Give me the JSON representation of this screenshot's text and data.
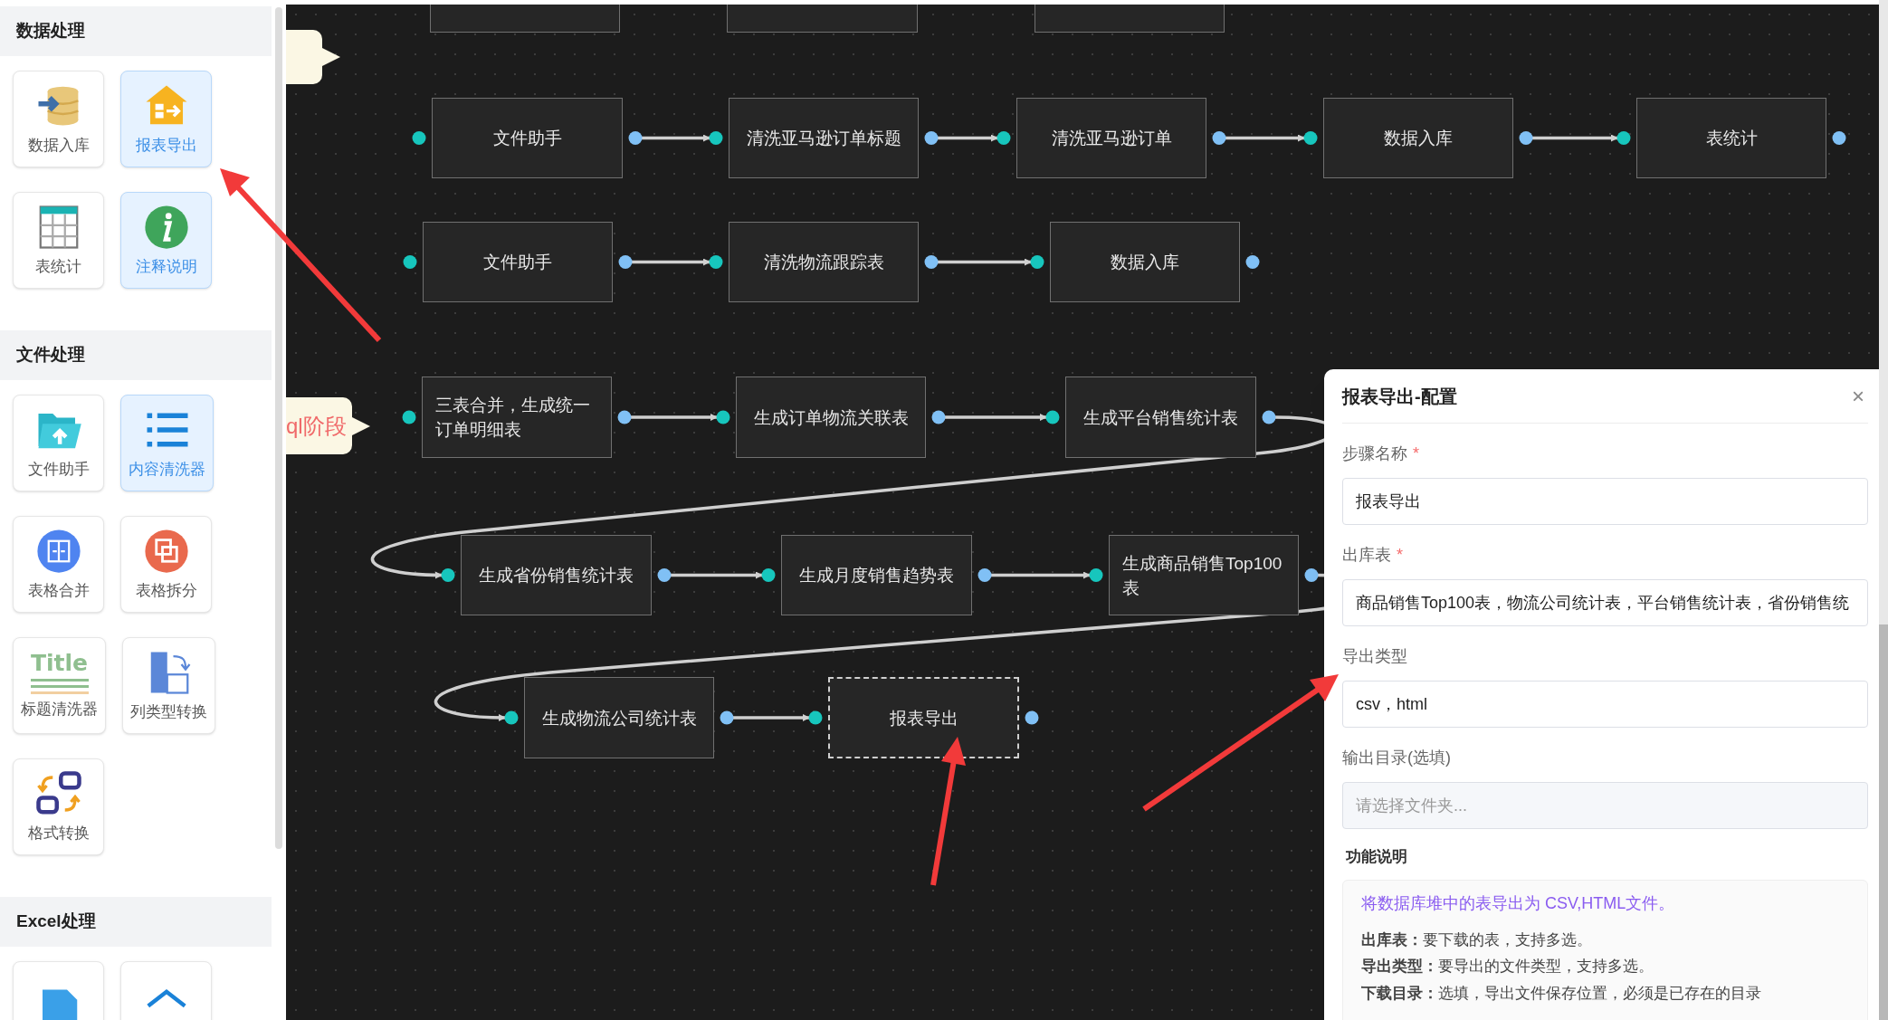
{
  "sidebar": {
    "sections": [
      {
        "title": "数据处理",
        "items": [
          {
            "label": "数据入库",
            "selected": false
          },
          {
            "label": "报表导出",
            "selected": true
          },
          {
            "label": "表统计",
            "selected": false
          },
          {
            "label": "注释说明",
            "selected": true
          }
        ]
      },
      {
        "title": "文件处理",
        "items": [
          {
            "label": "文件助手",
            "selected": false
          },
          {
            "label": "内容清洗器",
            "selected": true
          },
          {
            "label": "表格合并",
            "selected": false
          },
          {
            "label": "表格拆分",
            "selected": false
          },
          {
            "label": "标题清洗器",
            "selected": false,
            "icon_text": "Title"
          },
          {
            "label": "列类型转换",
            "selected": false
          },
          {
            "label": "格式转换",
            "selected": false
          }
        ]
      },
      {
        "title": "Excel处理",
        "items": [
          {
            "selected": false
          },
          {
            "selected": false
          }
        ]
      }
    ]
  },
  "canvas": {
    "callouts": [
      {
        "text": "ql阶段"
      }
    ],
    "nodes": [
      {
        "selected": false
      },
      {
        "selected": false
      },
      {
        "selected": false
      },
      {
        "label": "文件助手",
        "selected": false
      },
      {
        "label": "清洗亚马逊订单标题",
        "selected": false
      },
      {
        "label": "清洗亚马逊订单",
        "selected": false
      },
      {
        "label": "数据入库",
        "selected": false
      },
      {
        "label": "表统计",
        "selected": false
      },
      {
        "label": "文件助手",
        "selected": false
      },
      {
        "label": "清洗物流跟踪表",
        "selected": false
      },
      {
        "label": "数据入库",
        "selected": false
      },
      {
        "label": "三表合并，生成统一订单明细表",
        "selected": false
      },
      {
        "label": "生成订单物流关联表",
        "selected": false
      },
      {
        "label": "生成平台销售统计表",
        "selected": false
      },
      {
        "label": "生成省份销售统计表",
        "selected": false
      },
      {
        "label": "生成月度销售趋势表",
        "selected": false
      },
      {
        "label": "生成商品销售Top100表",
        "selected": false
      },
      {
        "label": "生成物流公司统计表",
        "selected": false
      },
      {
        "label": "报表导出",
        "selected": true
      }
    ]
  },
  "config_panel": {
    "title": "报表导出-配置",
    "close": "×",
    "fields": [
      {
        "label": "步骤名称",
        "required_mark": "*",
        "value": "报表导出"
      },
      {
        "label": "出库表",
        "required_mark": "*",
        "value": "商品销售Top100表，物流公司统计表，平台销售统计表，省份销售统"
      },
      {
        "label": "导出类型",
        "value": "csv，html"
      },
      {
        "label": "输出目录(选填)",
        "placeholder": "请选择文件夹..."
      }
    ],
    "help": {
      "title": "功能说明",
      "summary": "将数据库堆中的表导出为 CSV,HTML文件。",
      "lines": [
        "**出库表：**要下载的表，支持多选。",
        "**导出类型：**要导出的文件类型，支持多选。",
        "**下载目录：**选填，导出文件保存位置，必须是已存在的目录"
      ]
    }
  }
}
